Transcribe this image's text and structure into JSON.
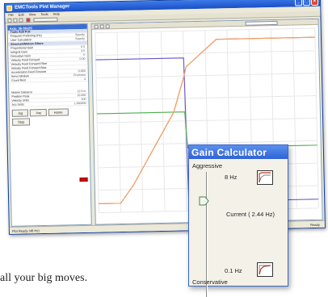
{
  "window": {
    "title": "EMCTools Pint Manager"
  },
  "menu": [
    "File",
    "Edit",
    "View",
    "Tools",
    "Help"
  ],
  "left_panel": {
    "header": "Axis: 36-36x2S",
    "rows": [
      {
        "label": "Tools Add Pull",
        "value": "",
        "section": true
      },
      {
        "label": "Frequent Preferring (Hz)",
        "value": "Specify"
      },
      {
        "label": "User Calculation",
        "value": "Specify"
      },
      {
        "label": "Structure/Motion Filters",
        "value": "",
        "section": true
      },
      {
        "label": "Proportional Gain",
        "value": "0.5"
      },
      {
        "label": "Integral Gain",
        "value": "4.5"
      },
      {
        "label": "Derivative Gain",
        "value": "0"
      },
      {
        "label": "Velocity Feed Forward",
        "value": "0.00"
      },
      {
        "label": "Velocity Feed Forward Filter",
        "value": ""
      },
      {
        "label": "Velocity Feed Forward Bias",
        "value": ""
      },
      {
        "label": "Acceleration Feed Forward",
        "value": "0.000"
      },
      {
        "label": "Servo Module",
        "value": "Precision"
      },
      {
        "label": "Count Rest",
        "value": "4"
      }
    ],
    "lower_rows": [
      {
        "label": "Motion Distance",
        "value": "12.0 in"
      },
      {
        "label": "Position Peak",
        "value": "10.000"
      },
      {
        "label": "Velocity Units",
        "value": "100"
      },
      {
        "label": "Acc Units",
        "value": "1.000000"
      }
    ],
    "buttons": [
      "Jog",
      "Jog",
      "Home",
      "Stop"
    ]
  },
  "status": {
    "left": "Plot Ready (48 Hz)",
    "right": "Ready"
  },
  "gain_calculator": {
    "title": "Gain Calculator",
    "top_label": "Aggressive",
    "top_value": "8 Hz",
    "current_label": "Current ( 2.44 Hz)",
    "bottom_value": "0.1 Hz",
    "bottom_label": "Conservative"
  },
  "caption": "all your big moves.",
  "colors": {
    "title_blue": "#1a4fc4",
    "trace_purple": "#6a52c8",
    "trace_green": "#4caf50",
    "trace_red": "#e26060",
    "trace_orange": "#f0a060"
  },
  "chart_data": {
    "type": "line",
    "title": "",
    "xlabel": "",
    "ylabel": "",
    "grid": true,
    "legend": "none",
    "x": [
      0,
      0.8,
      1.0,
      1.6,
      3.5,
      4.0,
      4.1,
      5.5,
      6.6,
      10.0
    ],
    "series": [
      {
        "color": "#6a52c8",
        "values": [
          0.85,
          0.85,
          0.85,
          0.85,
          0.85,
          0.85,
          0.05,
          0.05,
          0.05,
          0.05
        ]
      },
      {
        "color": "#4caf50",
        "values": [
          0.55,
          0.55,
          0.55,
          0.55,
          0.55,
          0.55,
          0.35,
          0.35,
          0.35,
          0.35
        ]
      },
      {
        "color": "#e26060",
        "values": [
          0.05,
          0.05,
          0.05,
          0.15,
          0.55,
          0.75,
          0.8,
          0.95,
          0.95,
          0.95
        ]
      },
      {
        "color": "#f0a060",
        "values": [
          0.05,
          0.05,
          0.05,
          0.15,
          0.55,
          0.75,
          0.8,
          0.95,
          0.95,
          0.95
        ]
      }
    ]
  }
}
